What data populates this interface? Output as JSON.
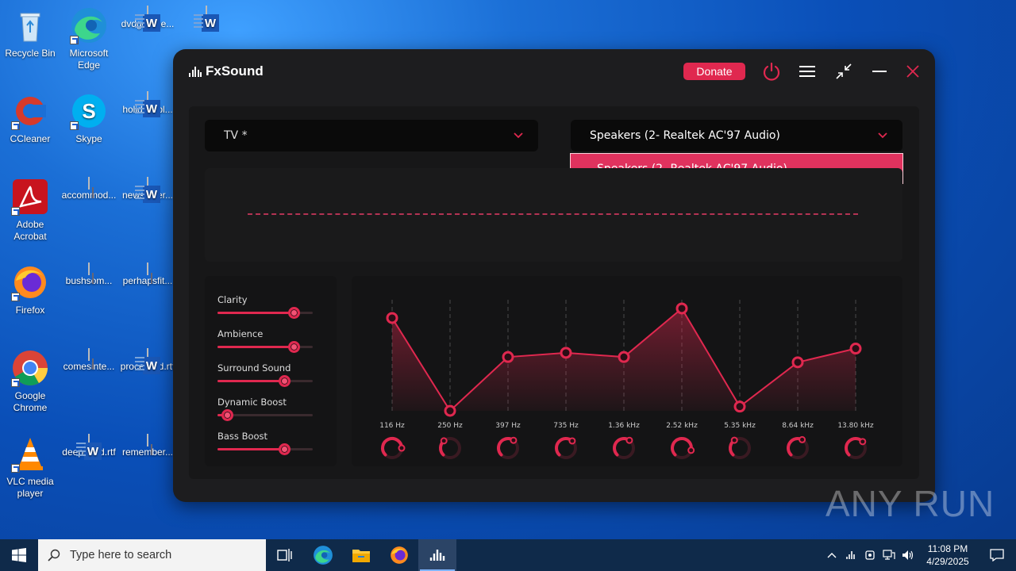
{
  "desktop": {
    "icons": [
      {
        "label": "Recycle Bin"
      },
      {
        "label": "Microsoft Edge"
      },
      {
        "label": "dvdgeorge..."
      },
      {
        "label": ""
      },
      {
        "label": "CCleaner"
      },
      {
        "label": "Skype"
      },
      {
        "label": "holidaysbl..."
      },
      {
        "label": "Adobe Acrobat"
      },
      {
        "label": "accommod..."
      },
      {
        "label": "newsletter..."
      },
      {
        "label": "Firefox"
      },
      {
        "label": "bushsom..."
      },
      {
        "label": "perhapsfit..."
      },
      {
        "label": "Google Chrome"
      },
      {
        "label": "comesinte..."
      },
      {
        "label": "processcd.rtf"
      },
      {
        "label": "VLC media player"
      },
      {
        "label": "deepneed.rtf"
      },
      {
        "label": "remember..."
      }
    ]
  },
  "app": {
    "title": "FxSound",
    "donate_label": "Donate",
    "preset": {
      "value": "TV *"
    },
    "device": {
      "value": "Speakers (2- Realtek AC'97 Audio)"
    },
    "device_options": [
      "Speakers (2- Realtek AC'97 Audio)"
    ],
    "effects": [
      {
        "name": "Clarity",
        "level": 0.8
      },
      {
        "name": "Ambience",
        "level": 0.8
      },
      {
        "name": "Surround Sound",
        "level": 0.7
      },
      {
        "name": "Dynamic Boost",
        "level": 0.1
      },
      {
        "name": "Bass Boost",
        "level": 0.7
      }
    ],
    "accent_color": "#e0284f"
  },
  "chart_data": {
    "type": "line",
    "categories": [
      "116 Hz",
      "250 Hz",
      "397 Hz",
      "735 Hz",
      "1.36 kHz",
      "2.52 kHz",
      "5.35 kHz",
      "8.64 kHz",
      "13.80 kHz"
    ],
    "series": [
      {
        "values": [
          0.88,
          0.0,
          0.51,
          0.55,
          0.51,
          0.97,
          0.04,
          0.46,
          0.59
        ]
      }
    ],
    "ylim": [
      0,
      1
    ],
    "title": "",
    "xlabel": "",
    "ylabel": ""
  },
  "taskbar": {
    "search_placeholder": "Type here to search",
    "time": "11:08 PM",
    "date": "4/29/2025"
  },
  "watermark": "ANY RUN"
}
